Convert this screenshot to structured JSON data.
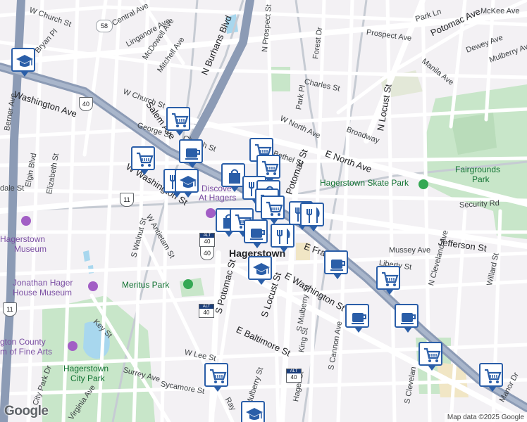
{
  "colors": {
    "background": "#f3f1f4",
    "road": "#ffffff",
    "highway": "#8c9bb5",
    "rail": "#c6cbd3",
    "park": "#c8e6c9",
    "water": "#a8d7ee",
    "marker_border": "#2a5ea8",
    "school_poi": "#a25ec5",
    "park_poi": "#34a853"
  },
  "streets": {
    "w_church_st_top": "W Church St",
    "bryan_pl": "Bryan Pl",
    "central_ave": "Central Ave",
    "linganore_ave": "Linganore Ave",
    "mcdowell_ave": "McDowell Ave",
    "mitchell_ave": "Mitchell Ave",
    "n_burhans_blvd": "N Burhans Blvd",
    "n_prospect_st": "N Prospect St",
    "forest_dr": "Forest Dr",
    "park_ln": "Park Ln",
    "potomac_ave": "Potomac Ave",
    "mckee_ave": "McKee Ave",
    "prospect_ave": "Prospect Ave",
    "dewey_ave": "Dewey Ave",
    "mulberry_ave": "Mulberry Ave",
    "manila_ave": "Manila Ave",
    "washington_ave": "Washington Ave",
    "salem_ave": "Salem Ave",
    "w_church_st": "W Church St",
    "charles_st": "Charles St",
    "park_pl": "Park Pl",
    "n_locust_st": "N Locust St",
    "berner_ave": "Berner Ave",
    "george_st": "George St",
    "w_north_ave": "W North Ave",
    "broadway": "Broadway",
    "elgin_blvd": "Elgin Blvd",
    "church_st": "Church St",
    "bethel_st": "Bethel St",
    "e_north_ave": "E North Ave",
    "elizabeth_st": "Elizabeth St",
    "w_washington_st": "W Washington St",
    "potomac_st": "Potomac St",
    "security_rd": "Security Rd",
    "dale_st": "dale St",
    "w_antietam_st": "W Antietam St",
    "jefferson_st": "Jefferson St",
    "s_walnut_st": "S Walnut St",
    "e_franklin": "E Fran",
    "mussey_ave": "Mussey Ave",
    "liberty_st": "Liberty St",
    "s_potomac_st": "S Potomac St",
    "e_washington_st": "E Washington St",
    "s_locust_st": "S Locust St",
    "s_mulberry_st": "S Mulberry St",
    "n_cleveland_ave": "N Cleveland Ave",
    "willard_st": "Willard St",
    "key_st": "Key St",
    "e_baltimore_st": "E Baltimore St",
    "s_cannon_ave": "S Cannon Ave",
    "king_st": "King St",
    "w_lee_st": "W Lee St",
    "surrey_ave": "Surrey Ave",
    "sycamore_st": "Sycamore St",
    "s_mulberry_st2": "S Mulberry St",
    "hager_st": "Hager St",
    "city_park_dr": "City Park Dr",
    "virginia_ave": "Virginia Ave",
    "s_cleveland": "S Clevelan",
    "manor_dr": "Manor Dr",
    "ray": "Ray"
  },
  "places": {
    "hagerstown": "Hagerstown",
    "discovery_station_1": "Discove",
    "discovery_station_2": "At Hagers",
    "hagerstown_museum_1": "Hagerstown",
    "hagerstown_museum_2": "Museum",
    "jonathan_hager_1": "Jonathan Hager",
    "jonathan_hager_2": "House Museum",
    "meritus_park": "Meritus Park",
    "skate_park": "Hagerstown Skate Park",
    "fairgrounds_1": "Fairgrounds",
    "fairgrounds_2": "Park",
    "museum_fine_arts_1": "gton County",
    "museum_fine_arts_2": "m of Fine Arts",
    "city_park_1": "Hagerstown",
    "city_park_2": "City Park"
  },
  "shields": {
    "md58": "58",
    "us40_a": "40",
    "us11_a": "11",
    "us40_b": "40",
    "us11_b": "11",
    "alt40_a": "40",
    "alt40_b": "40",
    "alt40_c": "40"
  },
  "markers": [
    {
      "icon": "school-icon"
    },
    {
      "icon": "grocery-cart-icon"
    },
    {
      "icon": "grocery-cart-icon"
    },
    {
      "icon": "coffee-icon"
    },
    {
      "icon": "restaurant-icon"
    },
    {
      "icon": "school-icon"
    },
    {
      "icon": "shopping-bag-icon"
    },
    {
      "icon": "grocery-cart-icon"
    },
    {
      "icon": "grocery-cart-icon"
    },
    {
      "icon": "restaurant-icon"
    },
    {
      "icon": "shopping-bag-icon"
    },
    {
      "icon": "grocery-cart-icon"
    },
    {
      "icon": "grocery-cart-icon"
    },
    {
      "icon": "restaurant-icon"
    },
    {
      "icon": "restaurant-icon"
    },
    {
      "icon": "shopping-bag-icon"
    },
    {
      "icon": "grocery-cart-icon"
    },
    {
      "icon": "coffee-icon"
    },
    {
      "icon": "restaurant-icon"
    },
    {
      "icon": "coffee-icon"
    },
    {
      "icon": "school-icon"
    },
    {
      "icon": "grocery-cart-icon"
    },
    {
      "icon": "coffee-icon"
    },
    {
      "icon": "coffee-icon"
    },
    {
      "icon": "grocery-cart-icon"
    },
    {
      "icon": "grocery-cart-icon"
    },
    {
      "icon": "grocery-cart-icon"
    },
    {
      "icon": "school-icon"
    }
  ],
  "logo": "Google",
  "attribution": "Map data ©2025 Google"
}
